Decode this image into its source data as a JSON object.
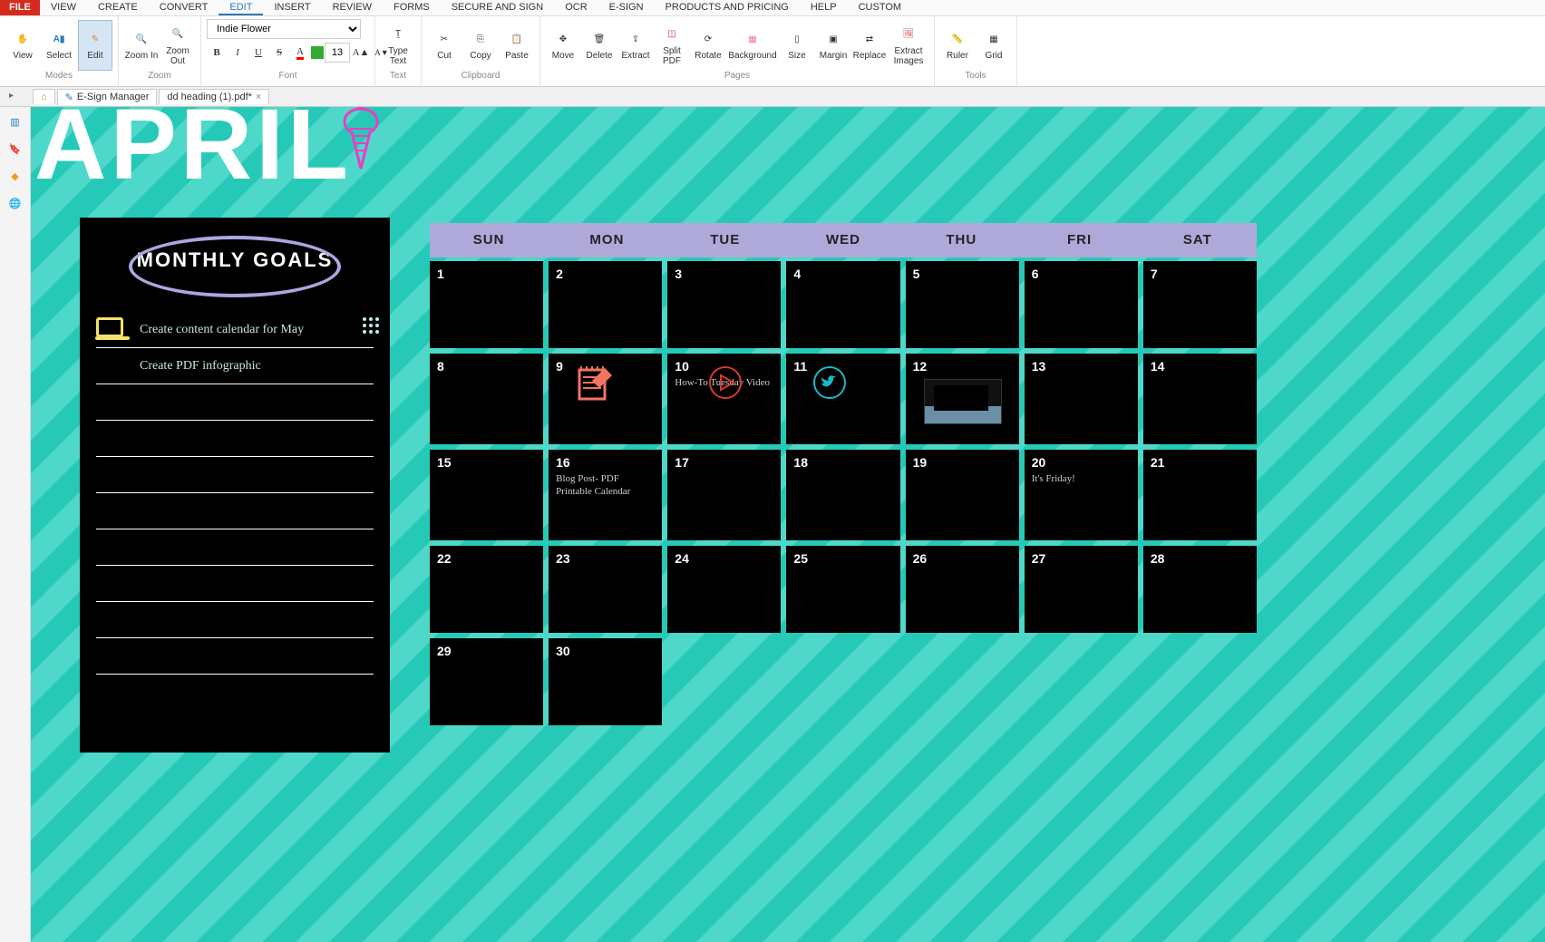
{
  "menu": {
    "file": "FILE",
    "items": [
      "VIEW",
      "CREATE",
      "CONVERT",
      "EDIT",
      "INSERT",
      "REVIEW",
      "FORMS",
      "SECURE AND SIGN",
      "OCR",
      "E-SIGN",
      "PRODUCTS AND PRICING",
      "HELP",
      "CUSTOM"
    ],
    "active": "EDIT"
  },
  "ribbon": {
    "groups": {
      "modes": {
        "label": "Modes",
        "buttons": [
          "View",
          "Select",
          "Edit"
        ]
      },
      "zoom": {
        "label": "Zoom",
        "buttons": [
          "Zoom In",
          "Zoom Out"
        ]
      },
      "font": {
        "label": "Font",
        "family": "Indie Flower",
        "size": "13"
      },
      "text": {
        "label": "Text",
        "buttons": [
          "Type Text"
        ]
      },
      "clipboard": {
        "label": "Clipboard",
        "buttons": [
          "Cut",
          "Copy",
          "Paste"
        ]
      },
      "pages": {
        "label": "Pages",
        "buttons": [
          "Move",
          "Delete",
          "Extract",
          "Split PDF",
          "Rotate",
          "Background",
          "Size",
          "Margin",
          "Replace",
          "Extract Images"
        ]
      },
      "tools": {
        "label": "Tools",
        "buttons": [
          "Ruler",
          "Grid"
        ]
      }
    }
  },
  "tabs": [
    {
      "icon": "home",
      "label": ""
    },
    {
      "icon": "pen",
      "label": "E-Sign Manager"
    },
    {
      "icon": "",
      "label": "dd heading (1).pdf*",
      "closable": true,
      "active": true
    }
  ],
  "document": {
    "month": "APRIL",
    "goals_title": "MONTHLY GOALS",
    "goals": [
      "Create content calendar for May",
      "Create PDF infographic",
      "",
      "",
      "",
      "",
      "",
      "",
      "",
      ""
    ],
    "day_headers": [
      "SUN",
      "MON",
      "TUE",
      "WED",
      "THU",
      "FRI",
      "SAT"
    ],
    "cells": [
      {
        "n": "1"
      },
      {
        "n": "2"
      },
      {
        "n": "3"
      },
      {
        "n": "4"
      },
      {
        "n": "5"
      },
      {
        "n": "6"
      },
      {
        "n": "7"
      },
      {
        "n": "8"
      },
      {
        "n": "9",
        "icon": "notepad"
      },
      {
        "n": "10",
        "icon": "play",
        "text": "How-To Tuesday Video"
      },
      {
        "n": "11",
        "icon": "twitter"
      },
      {
        "n": "12",
        "icon": "laptop-img"
      },
      {
        "n": "13"
      },
      {
        "n": "14"
      },
      {
        "n": "15"
      },
      {
        "n": "16",
        "text": "Blog Post- PDF Printable Calendar"
      },
      {
        "n": "17"
      },
      {
        "n": "18"
      },
      {
        "n": "19"
      },
      {
        "n": "20",
        "text": "It's Friday!"
      },
      {
        "n": "21"
      },
      {
        "n": "22"
      },
      {
        "n": "23"
      },
      {
        "n": "24"
      },
      {
        "n": "25"
      },
      {
        "n": "26"
      },
      {
        "n": "27"
      },
      {
        "n": "28"
      },
      {
        "n": "29"
      },
      {
        "n": "30"
      }
    ]
  }
}
